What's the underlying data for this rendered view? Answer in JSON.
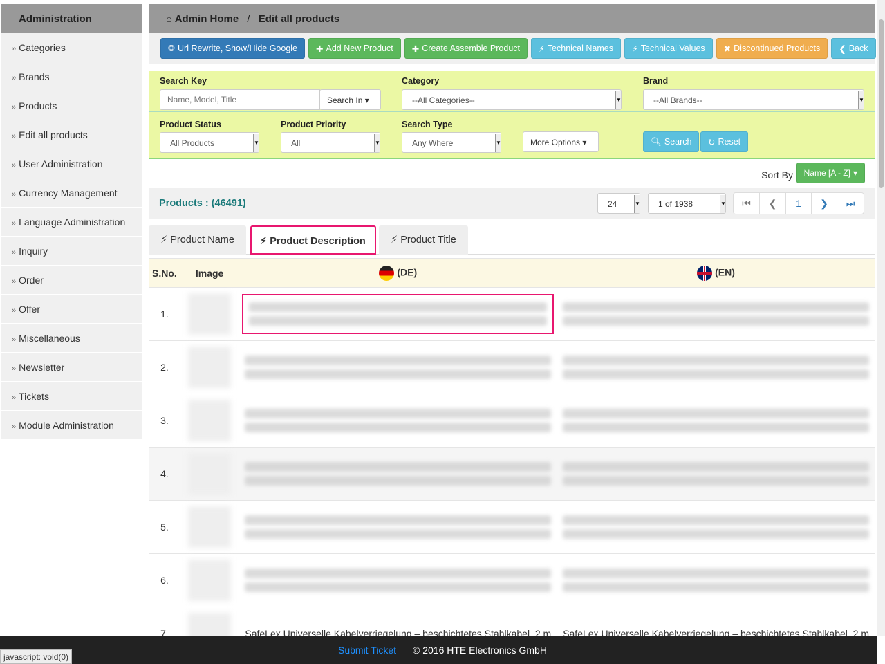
{
  "sidebar": {
    "title": "Administration",
    "items": [
      "Categories",
      "Brands",
      "Products",
      "Edit all products",
      "User Administration",
      "Currency Management",
      "Language Administration",
      "Inquiry",
      "Order",
      "Offer",
      "Miscellaneous",
      "Newsletter",
      "Tickets",
      "Module Administration"
    ]
  },
  "breadcrumb": {
    "home": "Admin Home",
    "sep": "/",
    "current": "Edit all products"
  },
  "toolbar": [
    {
      "label": "Url Rewrite, Show/Hide Google",
      "icon": "globe-icon",
      "color": "#337ab7"
    },
    {
      "label": "Add New Product",
      "icon": "plus-icon",
      "color": "#5cb85c"
    },
    {
      "label": "Create Assemble Product",
      "icon": "plus-icon",
      "color": "#5cb85c"
    },
    {
      "label": "Technical Names",
      "icon": "bolt-icon",
      "color": "#5bc0de"
    },
    {
      "label": "Technical Values",
      "icon": "bolt-icon",
      "color": "#5bc0de"
    },
    {
      "label": "Discontinued Products",
      "icon": "close-icon",
      "color": "#f0ad4e"
    },
    {
      "label": "Back",
      "icon": "chevron-left-icon",
      "color": "#5bc0de"
    }
  ],
  "filters": {
    "search_key_label": "Search Key",
    "search_placeholder": "Name, Model, Title",
    "search_in": "Search In",
    "category_label": "Category",
    "category_value": "--All Categories--",
    "brand_label": "Brand",
    "brand_value": "--All Brands--",
    "status_label": "Product Status",
    "status_value": "All Products",
    "priority_label": "Product Priority",
    "priority_value": "All",
    "type_label": "Search Type",
    "type_value": "Any Where",
    "more_options": "More Options",
    "search_btn": "Search",
    "reset_btn": "Reset"
  },
  "sort": {
    "label": "Sort By",
    "value": "Name [A - Z]"
  },
  "pager": {
    "count_label": "Products : (46491)",
    "per_page": "24",
    "page_select": "1 of 1938",
    "current_page": "1"
  },
  "tabs": [
    {
      "label": "Product Name"
    },
    {
      "label": "Product Description",
      "active": true
    },
    {
      "label": "Product Title"
    }
  ],
  "table": {
    "headers": [
      "S.No.",
      "Image",
      "(DE)",
      "(EN)"
    ],
    "rows": [
      "1.",
      "2.",
      "3.",
      "4.",
      "5.",
      "6.",
      "7."
    ],
    "row7_de": "SafeLex Universelle Kabelverriegelung – beschichtetes Stahlkabel, 2 m",
    "row7_en": "SafeLex Universelle Kabelverriegelung – beschichtetes Stahlkabel, 2 m"
  },
  "footer": {
    "link": "Submit Ticket",
    "copyright": "© 2016 HTE Electronics GmbH"
  },
  "statusbar": "javascript: void(0)",
  "colors": {
    "accent": "#e8176f",
    "products_count": "#1a7a7a",
    "filter_bg": "#ebf8a4"
  }
}
